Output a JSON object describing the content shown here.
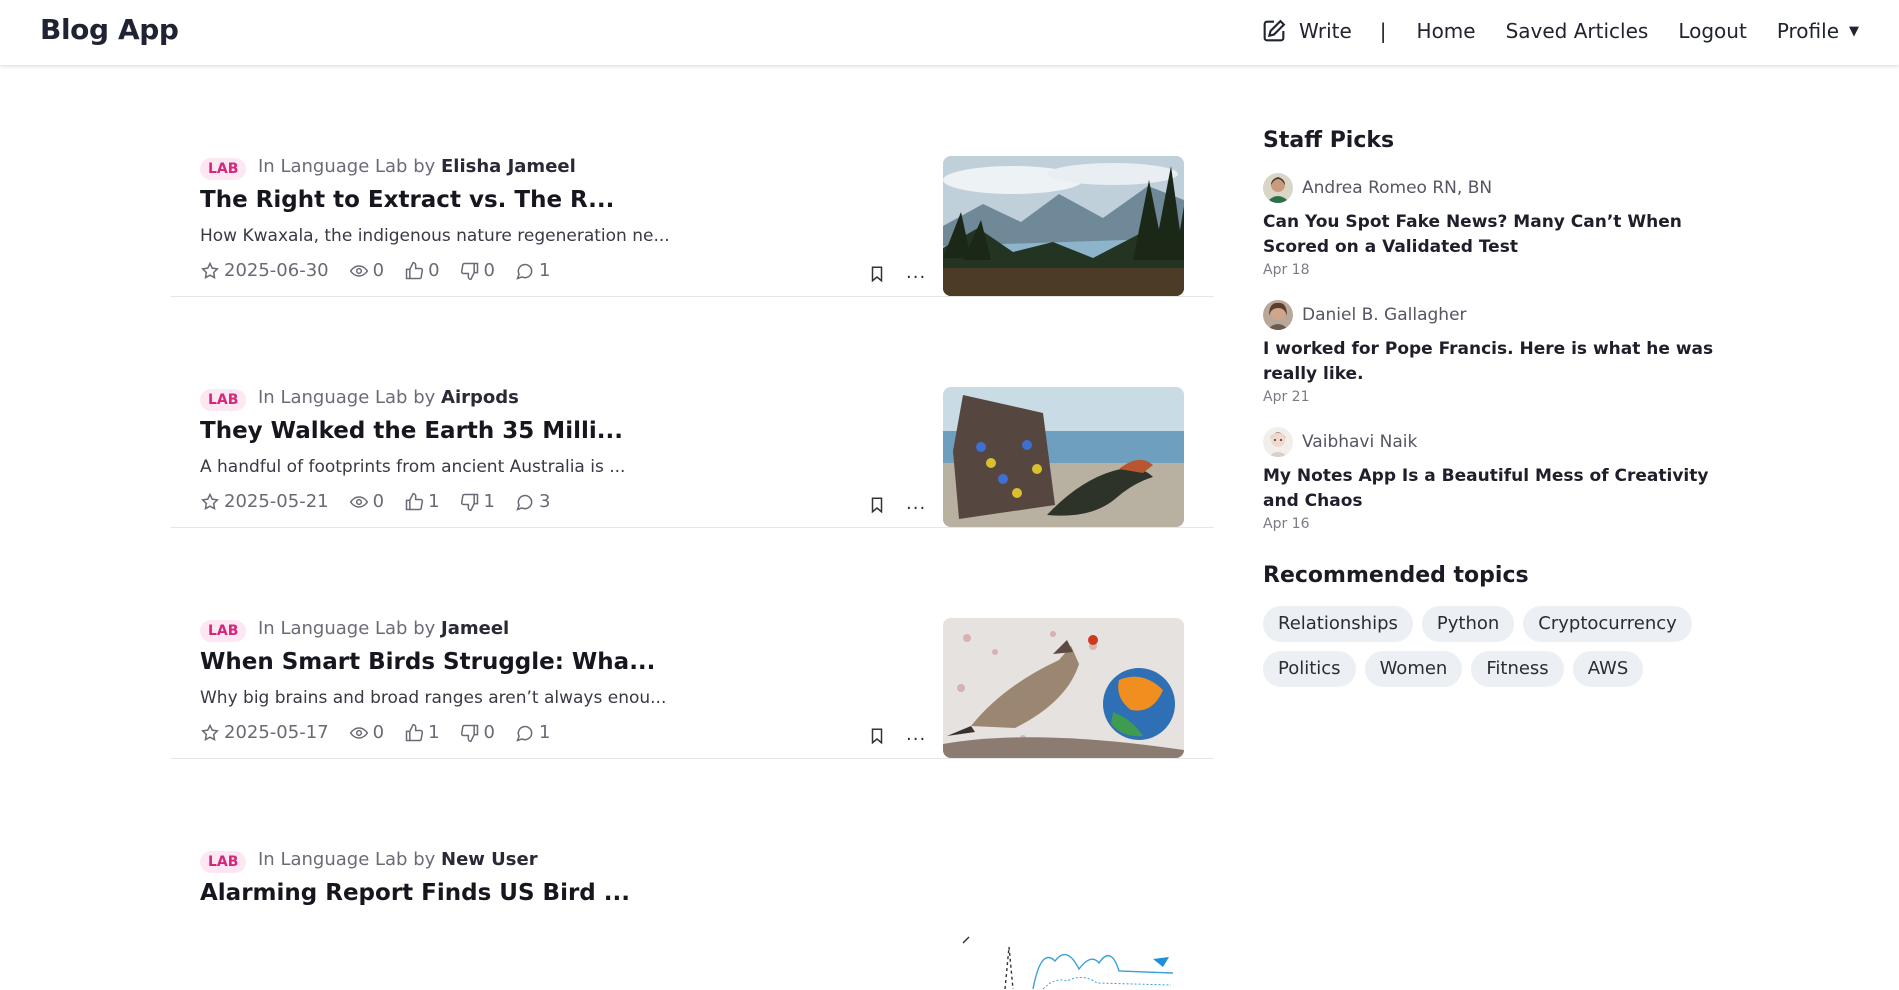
{
  "app": {
    "brand": "Blog App"
  },
  "nav": {
    "write": "Write",
    "separator": "|",
    "home": "Home",
    "saved": "Saved Articles",
    "logout": "Logout",
    "profile": "Profile",
    "caret": "▼"
  },
  "articles": [
    {
      "badge": "LAB",
      "prefix": "In Language Lab by",
      "author": "Elisha Jameel",
      "title": "The Right to Extract vs. The R...",
      "excerpt": "How Kwaxala, the indigenous nature regeneration ne...",
      "date": "2025-06-30",
      "views": "0",
      "likes": "0",
      "dislikes": "0",
      "comments": "1",
      "more": "...",
      "image": "mountain-lake-photo"
    },
    {
      "badge": "LAB",
      "prefix": "In Language Lab by",
      "author": "Airpods",
      "title": "They Walked the Earth 35 Milli...",
      "excerpt": "A handful of footprints from ancient Australia is ...",
      "date": "2025-05-21",
      "views": "0",
      "likes": "1",
      "dislikes": "1",
      "comments": "3",
      "more": "...",
      "image": "rock-footprints-crocodile-photo"
    },
    {
      "badge": "LAB",
      "prefix": "In Language Lab by",
      "author": "Jameel",
      "title": "When Smart Birds Struggle: Wha...",
      "excerpt": "Why big brains and broad ranges aren’t always enou...",
      "date": "2025-05-17",
      "views": "0",
      "likes": "1",
      "dislikes": "0",
      "comments": "1",
      "more": "...",
      "image": "waxwing-globe-photo"
    },
    {
      "badge": "LAB",
      "prefix": "In Language Lab by",
      "author": "New User",
      "title": "Alarming Report Finds US Bird ...",
      "excerpt": "",
      "date": "",
      "views": "",
      "likes": "",
      "dislikes": "",
      "comments": "",
      "more": "",
      "image": "bird-line-graph-illustration"
    }
  ],
  "sidebar": {
    "staff_title": "Staff Picks",
    "picks": [
      {
        "author": "Andrea Romeo RN, BN",
        "title": "Can You Spot Fake News? Many Can’t When Scored on a Validated Test",
        "date": "Apr 18"
      },
      {
        "author": "Daniel B. Gallagher",
        "title": "I worked for Pope Francis. Here is what he was really like.",
        "date": "Apr 21"
      },
      {
        "author": "Vaibhavi Naik",
        "title": "My Notes App Is a Beautiful Mess of Creativity and Chaos",
        "date": "Apr 16"
      }
    ],
    "topics_title": "Recommended topics",
    "topics": [
      "Relationships",
      "Python",
      "Cryptocurrency",
      "Politics",
      "Women",
      "Fitness",
      "AWS"
    ]
  },
  "colors": {
    "badge_bg": "#fde7f3",
    "badge_text": "#d4277c",
    "topic_bg": "#eceff3",
    "divider": "#e6e6e6"
  }
}
